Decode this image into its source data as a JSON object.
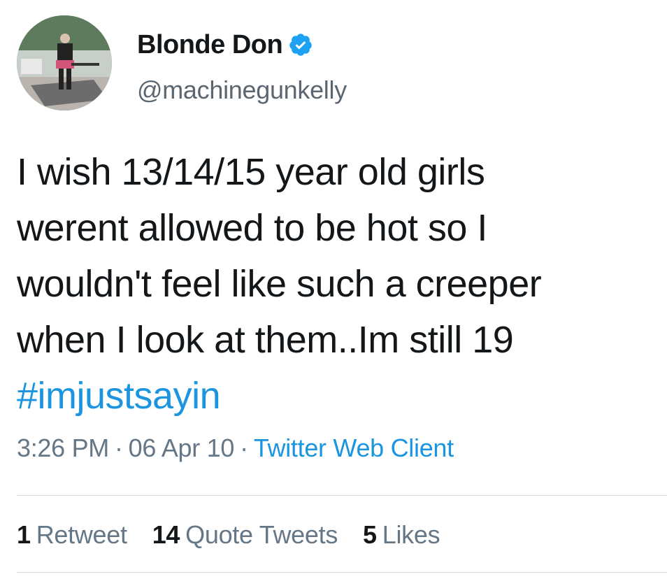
{
  "user": {
    "display_name": "Blonde Don",
    "handle": "@machinegunkelly",
    "verified": true,
    "avatar_icon": "profile-photo",
    "accent_color": "#1da1f2"
  },
  "tweet": {
    "lines": [
      "I wish 13/14/15 year old girls",
      "werent allowed to be hot so I",
      "wouldn't feel like such a creeper",
      "when I look at them..Im still 19"
    ],
    "hashtag": "#imjustsayin",
    "hashtag_color": "#1b95e0"
  },
  "meta": {
    "time": "3:26 PM",
    "date": "06 Apr 10",
    "separator": "·",
    "source": "Twitter Web Client"
  },
  "stats": [
    {
      "count": "1",
      "label": "Retweet"
    },
    {
      "count": "14",
      "label": "Quote Tweets"
    },
    {
      "count": "5",
      "label": "Likes"
    }
  ]
}
